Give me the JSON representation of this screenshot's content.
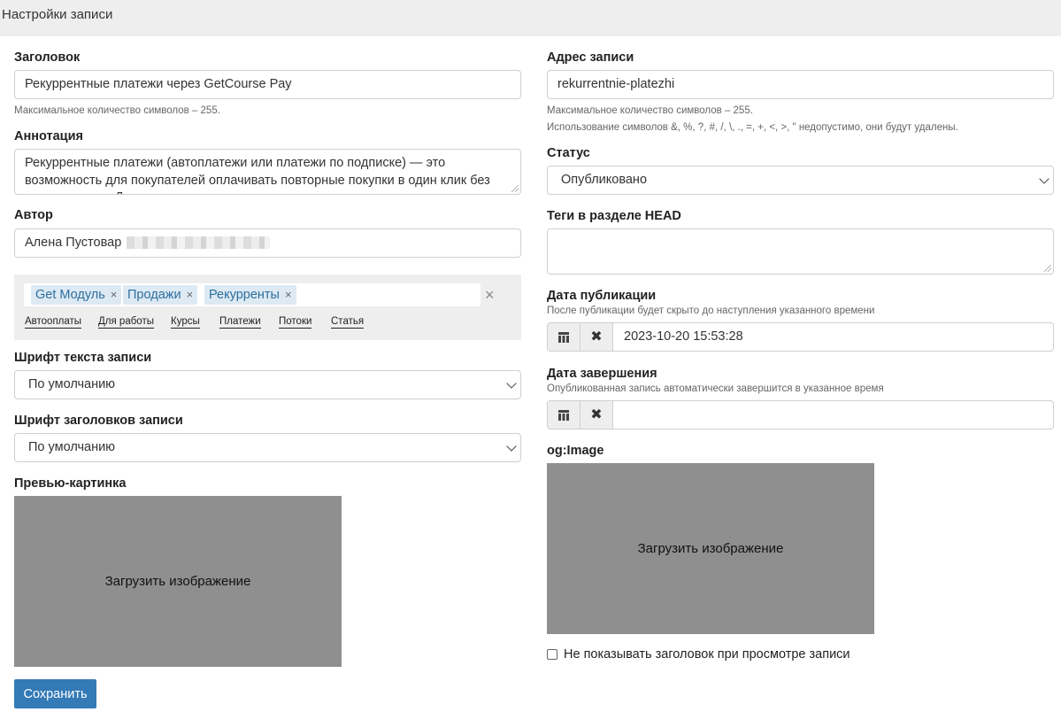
{
  "header": {
    "title": "Настройки записи"
  },
  "form": {
    "title": {
      "label": "Заголовок",
      "value": "Рекуррентные платежи через GetCourse Pay",
      "help": "Максимальное количество символов – 255."
    },
    "annotation": {
      "label": "Аннотация",
      "value": "Рекуррентные платежи (автоплатежи или платежи по подписке) — это возможность для покупателей оплачивать повторные покупки в один клик без ввода данных. Для"
    },
    "author": {
      "label": "Автор",
      "value": "Алена Пустовар"
    },
    "tags": {
      "selected": [
        "Get Модуль",
        "Продажи",
        "Рекурренты"
      ],
      "suggestions": [
        "Автооплаты",
        "Для работы",
        "Курсы",
        "Платежи",
        "Потоки",
        "Статья"
      ],
      "remove_glyph": "×",
      "clear_glyph": "×"
    },
    "body_font": {
      "label": "Шрифт текста записи",
      "value": "По умолчанию"
    },
    "heading_font": {
      "label": "Шрифт заголовков записи",
      "value": "По умолчанию"
    },
    "preview_image": {
      "label": "Превью-картинка",
      "upload_text": "Загрузить изображение"
    },
    "address": {
      "label": "Адрес записи",
      "value": "rekurrentnie-platezhi",
      "help1": "Максимальное количество символов – 255.",
      "help2": "Использование символов &, %, ?, #, /, \\, ., =, +, <, >, \" недопустимо, они будут удалены."
    },
    "status": {
      "label": "Статус",
      "value": "Опубликовано"
    },
    "head_tags": {
      "label": "Теги в разделе HEAD",
      "value": ""
    },
    "publish_date": {
      "label": "Дата публикации",
      "help": "После публикации будет скрыто до наступления указанного времени",
      "value": "2023-10-20 15:53:28"
    },
    "end_date": {
      "label": "Дата завершения",
      "help": "Опубликованная запись автоматически завершится в указанное время",
      "value": ""
    },
    "og_image": {
      "label": "og:Image",
      "upload_text": "Загрузить изображение"
    },
    "hide_title": {
      "label": "Не показывать заголовок при просмотре записи",
      "checked": false
    },
    "save_button": "Сохранить"
  },
  "colors": {
    "primary": "#337ab7",
    "chip_bg": "#dde9f3",
    "chip_text": "#2e6f9e",
    "image_placeholder": "#8f8f8f"
  }
}
